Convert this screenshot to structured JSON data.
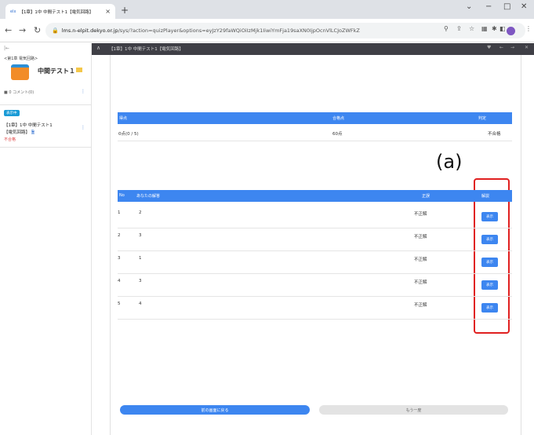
{
  "browser": {
    "tab_title": "【1章】1中 中間テスト1【電気回路】",
    "tab_favicon": "elx",
    "url_host": "lms.n-elpit.dekyo.or.jp",
    "url_rest": "/sys/?action=quizPlayer&options=eyJzY29faWQiOiIzMjk1IiwiYmFja19saXN0IjpOcnVlLCJoZWFkZXIiOn..."
  },
  "sidebar": {
    "collapse": "|←",
    "chapter": "<第1章 電気回路>",
    "course_title": "中間テスト１",
    "comment": "■ 0 コメント(0)",
    "badge": "表示中",
    "item_line1": "【1章】1中 中間テスト1",
    "item_line2": "【電気回路】",
    "status": "不合格"
  },
  "player": {
    "title": "【1章】1中 中間テスト1【電気回路】"
  },
  "summary": {
    "headers": {
      "score": "得点",
      "pass": "合格点",
      "judge": "判定"
    },
    "score": "0点(0 / 5)",
    "pass": "60点",
    "judge": "不合格"
  },
  "results": {
    "headers": {
      "no": "No",
      "answer": "あなたの解答",
      "correct": "正誤",
      "explain": "解説"
    },
    "view_label": "表示",
    "rows": [
      {
        "no": "1",
        "answer": "2",
        "correct": "不正解"
      },
      {
        "no": "2",
        "answer": "3",
        "correct": "不正解"
      },
      {
        "no": "3",
        "answer": "1",
        "correct": "不正解"
      },
      {
        "no": "4",
        "answer": "3",
        "correct": "不正解"
      },
      {
        "no": "5",
        "answer": "4",
        "correct": "不正解"
      }
    ]
  },
  "buttons": {
    "back": "前の画面に戻る",
    "retry": "もう一度"
  },
  "annotation": {
    "label": "(a)"
  },
  "colors": {
    "accent": "#3d86f0",
    "annotation": "#e02020",
    "fail": "#e04545"
  }
}
